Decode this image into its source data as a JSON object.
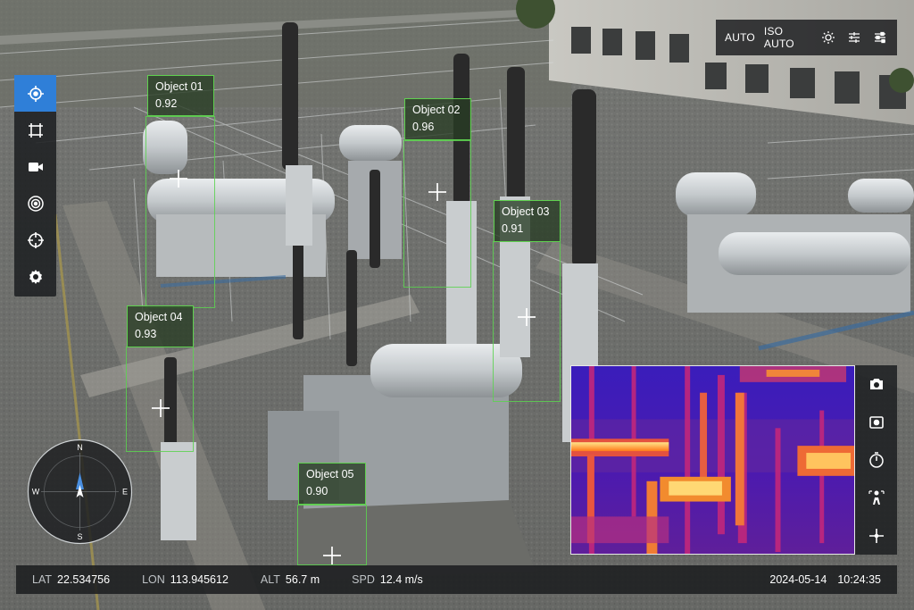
{
  "camera_settings": {
    "exposure_mode": "AUTO",
    "iso_mode": "ISO AUTO",
    "icons": [
      "brightness-icon",
      "sliders-icon",
      "adjust-icon"
    ]
  },
  "left_toolbar": {
    "active": "target-icon",
    "icons": [
      "target-icon",
      "frame-select-icon",
      "video-camera-icon",
      "radar-target-icon",
      "crosshair-icon",
      "settings-gear-icon"
    ]
  },
  "detections": [
    {
      "name": "Object 01",
      "confidence": "0.92"
    },
    {
      "name": "Object 02",
      "confidence": "0.96"
    },
    {
      "name": "Object 03",
      "confidence": "0.91"
    },
    {
      "name": "Object 04",
      "confidence": "0.93"
    },
    {
      "name": "Object 05",
      "confidence": "0.90"
    }
  ],
  "compass": {
    "n": "N",
    "e": "E",
    "s": "S",
    "w": "W"
  },
  "thermal_tools": {
    "icons": [
      "camera-icon",
      "switch-camera-icon",
      "timer-icon",
      "person-detect-icon",
      "crosshair-icon"
    ]
  },
  "telemetry": {
    "lat_label": "LAT",
    "lat": "22.534756",
    "lon_label": "LON",
    "lon": "113.945612",
    "alt_label": "ALT",
    "alt": "56.7 m",
    "spd_label": "SPD",
    "spd": "12.4 m/s",
    "date": "2024-05-14",
    "time": "10:24:35"
  },
  "colors": {
    "accent": "#2f7fd8",
    "detection": "#5fd14f",
    "panel": "#1e2022"
  }
}
